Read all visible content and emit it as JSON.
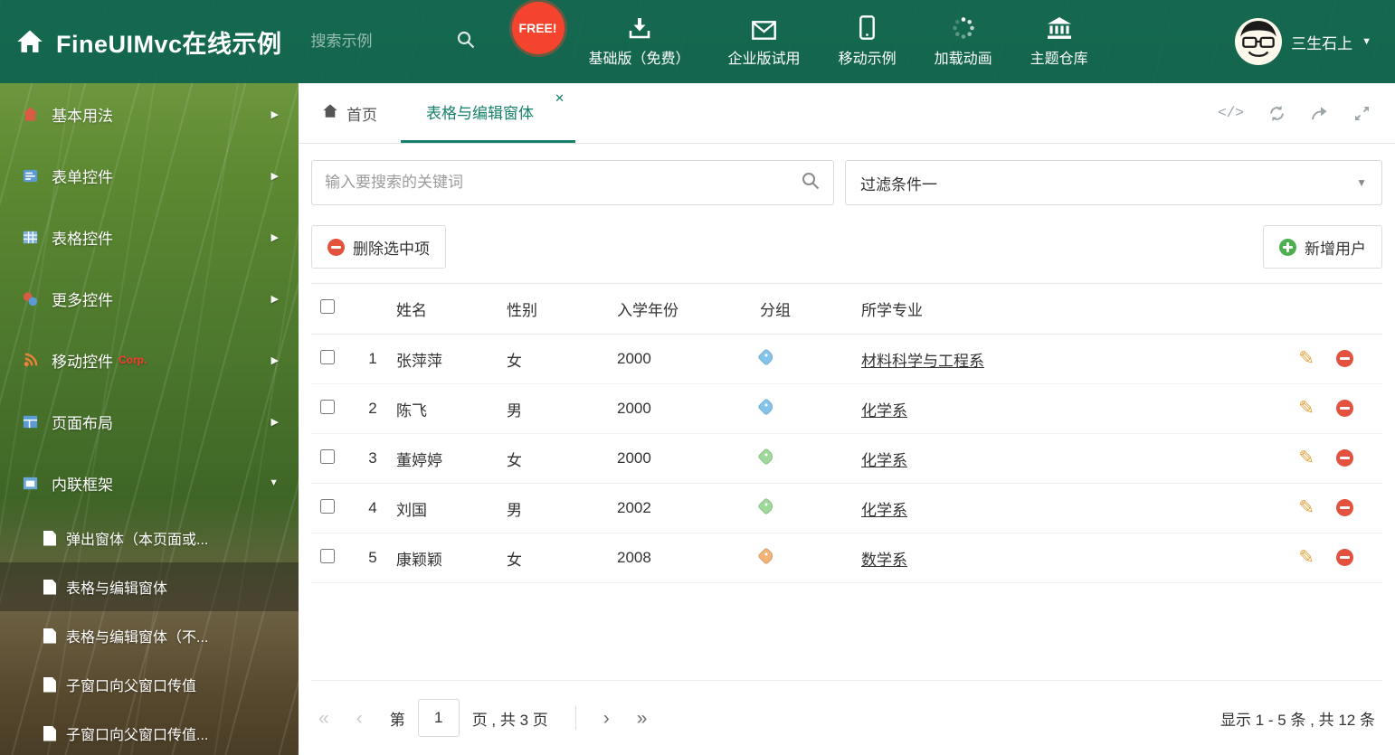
{
  "header": {
    "title": "FineUIMvc在线示例",
    "search_placeholder": "搜索示例",
    "free_badge": "FREE!",
    "nav": [
      {
        "label": "基础版（免费）"
      },
      {
        "label": "企业版试用"
      },
      {
        "label": "移动示例"
      },
      {
        "label": "加载动画"
      },
      {
        "label": "主题仓库"
      }
    ],
    "user_name": "三生石上"
  },
  "sidebar": {
    "items": [
      {
        "label": "基本用法"
      },
      {
        "label": "表单控件"
      },
      {
        "label": "表格控件"
      },
      {
        "label": "更多控件"
      },
      {
        "label": "移动控件",
        "badge": "Corp."
      },
      {
        "label": "页面布局"
      },
      {
        "label": "内联框架"
      }
    ],
    "subitems": [
      {
        "label": "弹出窗体（本页面或..."
      },
      {
        "label": "表格与编辑窗体"
      },
      {
        "label": "表格与编辑窗体（不..."
      },
      {
        "label": "子窗口向父窗口传值"
      },
      {
        "label": "子窗口向父窗口传值..."
      }
    ]
  },
  "tabs": {
    "home": "首页",
    "active": "表格与编辑窗体"
  },
  "filter": {
    "search_placeholder": "输入要搜索的关键词",
    "dropdown_value": "过滤条件一"
  },
  "toolbar": {
    "delete_label": "删除选中项",
    "add_label": "新增用户"
  },
  "table": {
    "columns": {
      "name": "姓名",
      "gender": "性别",
      "year": "入学年份",
      "group": "分组",
      "major": "所学专业"
    },
    "rows": [
      {
        "num": "1",
        "name": "张萍萍",
        "gender": "女",
        "year": "2000",
        "tag_color": "#85C4EA",
        "major": "材料科学与工程系"
      },
      {
        "num": "2",
        "name": "陈飞",
        "gender": "男",
        "year": "2000",
        "tag_color": "#85C4EA",
        "major": "化学系"
      },
      {
        "num": "3",
        "name": "董婷婷",
        "gender": "女",
        "year": "2000",
        "tag_color": "#9FD89B",
        "major": "化学系"
      },
      {
        "num": "4",
        "name": "刘国",
        "gender": "男",
        "year": "2002",
        "tag_color": "#9FD89B",
        "major": "化学系"
      },
      {
        "num": "5",
        "name": "康颖颖",
        "gender": "女",
        "year": "2008",
        "tag_color": "#F2B377",
        "major": "数学系"
      }
    ]
  },
  "pagination": {
    "prefix": "第",
    "current_page": "1",
    "suffix": "页 , 共 3 页",
    "summary": "显示 1 - 5 条 , 共 12 条"
  },
  "icons": {
    "chevron_right": "▶",
    "chevron_down": "▼",
    "close": "✕",
    "pencil": "✎",
    "code": "</>",
    "first": "«",
    "prev": "‹",
    "next": "›",
    "last": "»"
  },
  "colors": {
    "theme": "#0A6250",
    "active_tab": "#17806C",
    "delete_red": "#E2523E",
    "add_green": "#4CAF50",
    "pencil_orange": "#E8A33D"
  }
}
